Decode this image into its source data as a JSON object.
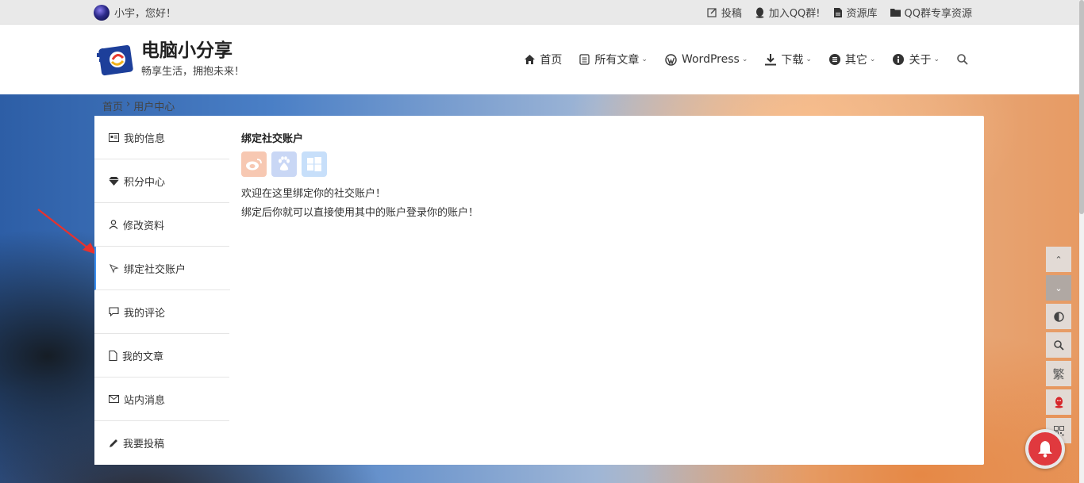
{
  "topbar": {
    "greeting": "小宇，您好！",
    "links": [
      {
        "icon": "edit-icon",
        "label": "投稿"
      },
      {
        "icon": "qq-icon",
        "label": "加入QQ群!"
      },
      {
        "icon": "file-icon",
        "label": "资源库"
      },
      {
        "icon": "folder-icon",
        "label": "QQ群专享资源"
      }
    ]
  },
  "header": {
    "site_title": "电脑小分享",
    "site_subtitle": "畅享生活，拥抱未来！",
    "nav": [
      {
        "icon": "home-icon",
        "label": "首页",
        "dropdown": false
      },
      {
        "icon": "document-icon",
        "label": "所有文章",
        "dropdown": true
      },
      {
        "icon": "wordpress-icon",
        "label": "WordPress",
        "dropdown": true
      },
      {
        "icon": "download-icon",
        "label": "下载",
        "dropdown": true
      },
      {
        "icon": "list-icon",
        "label": "其它",
        "dropdown": true
      },
      {
        "icon": "info-icon",
        "label": "关于",
        "dropdown": true
      }
    ]
  },
  "breadcrumb": {
    "home": "首页",
    "separator": "›",
    "current": "用户中心"
  },
  "sidebar": {
    "items": [
      {
        "icon": "id-card-icon",
        "label": "我的信息"
      },
      {
        "icon": "diamond-icon",
        "label": "积分中心"
      },
      {
        "icon": "user-icon",
        "label": "修改资料"
      },
      {
        "icon": "link-pointer-icon",
        "label": "绑定社交账户",
        "active": true
      },
      {
        "icon": "comment-icon",
        "label": "我的评论"
      },
      {
        "icon": "file-icon",
        "label": "我的文章"
      },
      {
        "icon": "mail-icon",
        "label": "站内消息"
      },
      {
        "icon": "pencil-icon",
        "label": "我要投稿"
      }
    ]
  },
  "content": {
    "title": "绑定社交账户",
    "social_buttons": [
      {
        "icon": "weibo-icon",
        "color": "#f7c8b2"
      },
      {
        "icon": "baidu-icon",
        "color": "#c9d7f5"
      },
      {
        "icon": "windows-icon",
        "color": "#c7dffa"
      }
    ],
    "line1": "欢迎在这里绑定你的社交账户！",
    "line2": "绑定后你就可以直接使用其中的账户登录你的账户！"
  },
  "tools": [
    {
      "icon": "chevron-up-icon"
    },
    {
      "icon": "chevron-down-icon"
    },
    {
      "icon": "contrast-icon"
    },
    {
      "icon": "search-icon"
    },
    {
      "icon": "traditional-chinese-icon",
      "label": "繁"
    },
    {
      "icon": "qq-icon"
    },
    {
      "icon": "qrcode-icon"
    }
  ],
  "colors": {
    "accent": "#3b8ff0",
    "notify": "#e0393e"
  }
}
